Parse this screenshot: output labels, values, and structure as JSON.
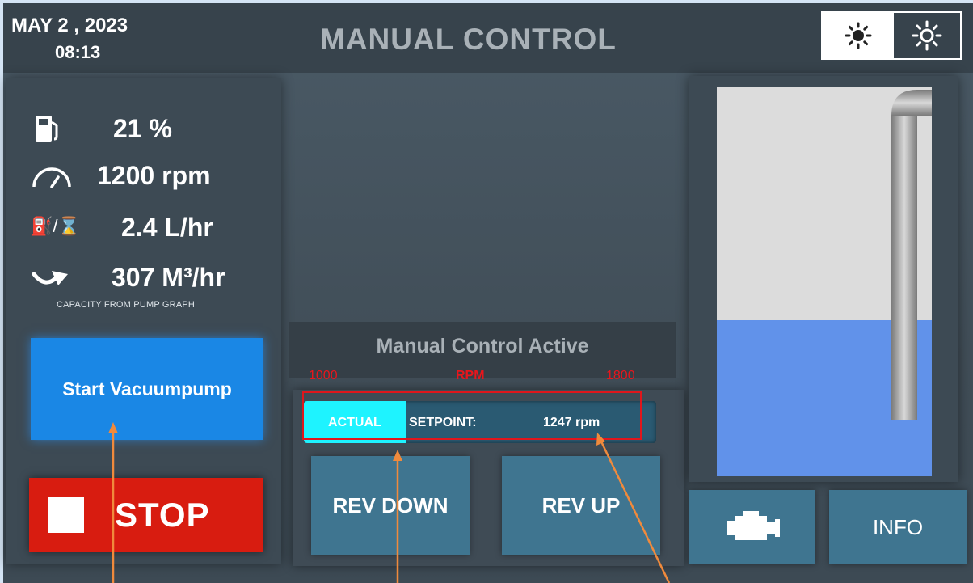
{
  "header": {
    "date": "MAY  2 , 2023",
    "time": "08:13",
    "title": "MANUAL CONTROL",
    "theme_icons": [
      "sun-icon",
      "sun-outline-icon"
    ]
  },
  "stats": {
    "fuel": {
      "icon": "fuel-pump-icon",
      "value": "21 %"
    },
    "speed": {
      "icon": "gauge-icon",
      "value": "1200 rpm"
    },
    "consumption": {
      "icon": "fuel-per-hour-icon",
      "icon_text": "⛽/⌛",
      "value": "2.4 L/hr"
    },
    "flow": {
      "icon": "flow-arrow-icon",
      "value": "307 M³/hr"
    },
    "capacity_note": "CAPACITY FROM PUMP GRAPH"
  },
  "buttons": {
    "start": "Start Vacuumpump",
    "stop": "STOP",
    "rev_down": "REV DOWN",
    "rev_up": "REV UP",
    "info": "INFO",
    "engine_icon": "engine-icon"
  },
  "status": "Manual Control Active",
  "rpm_bar": {
    "actual_label": "ACTUAL",
    "setpoint_label": "SETPOINT:",
    "setpoint_value": "1247 rpm",
    "actual_fraction": 0.29,
    "fill_color": "#1ef3ff"
  },
  "annotation": {
    "min_label": "1000",
    "unit_label": "RPM",
    "max_label": "1800",
    "color": "#e8161c",
    "arrow_color": "#f08a3c"
  },
  "tank": {
    "level_fraction": 0.4,
    "water_color": "#6192ea"
  },
  "colors": {
    "start_button": "#1a87e5",
    "stop_button": "#d81c10",
    "action_button": "#3f7590",
    "background": "#414e58"
  }
}
